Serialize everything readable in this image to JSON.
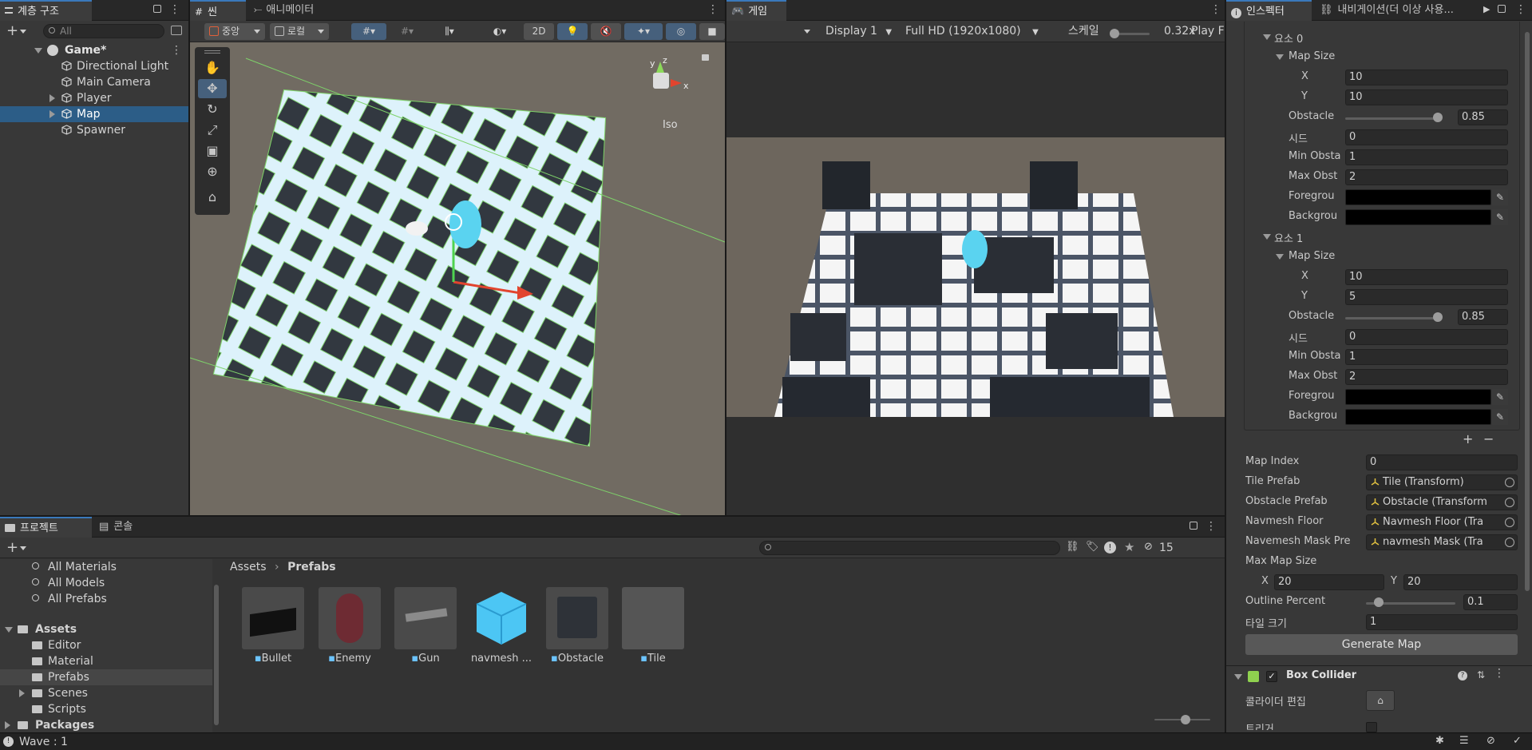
{
  "hierarchy": {
    "tab_label": "계층 구조",
    "search_placeholder": "All",
    "scene_name": "Game*",
    "items": [
      "Directional Light",
      "Main Camera",
      "Player",
      "Map",
      "Spawner"
    ]
  },
  "scene_view": {
    "tab_label": "씬",
    "animator_tab_label": "애니메이터",
    "pivot_label": "중앙",
    "space_label": "로컬",
    "mode_2d_label": "2D",
    "iso_label": "Iso",
    "gizmo_axes": [
      "x",
      "y",
      "z"
    ]
  },
  "game_view": {
    "tab_label": "게임",
    "display_label": "Display 1",
    "resolution_label": "Full HD (1920x1080)",
    "scale_label": "스케일",
    "scale_value": "0.32x",
    "play_label": "Play F"
  },
  "inspector": {
    "tab_label": "인스펙터",
    "navigation_tab_label": "내비게이션(더 이상 사용...",
    "elements": [
      {
        "title": "요소 0",
        "map_size_label": "Map Size",
        "x_label": "X",
        "x_value": "10",
        "y_label": "Y",
        "y_value": "10",
        "obstacle_label": "Obstacle",
        "obstacle_value": "0.85",
        "obstacle_fraction": 0.85,
        "seed_label": "시드",
        "seed_value": "0",
        "min_label": "Min Obsta",
        "min_value": "1",
        "max_label": "Max Obst",
        "max_value": "2",
        "fg_label": "Foregrou",
        "fg_color": "#000000",
        "bg_label": "Backgrou",
        "bg_color": "#000000"
      },
      {
        "title": "요소 1",
        "map_size_label": "Map Size",
        "x_label": "X",
        "x_value": "10",
        "y_label": "Y",
        "y_value": "5",
        "obstacle_label": "Obstacle",
        "obstacle_value": "0.85",
        "obstacle_fraction": 0.85,
        "seed_label": "시드",
        "seed_value": "0",
        "min_label": "Min Obsta",
        "min_value": "1",
        "max_label": "Max Obst",
        "max_value": "2",
        "fg_label": "Foregrou",
        "fg_color": "#000000",
        "bg_label": "Backgrou",
        "bg_color": "#000000"
      }
    ],
    "add_label": "+",
    "remove_label": "−",
    "map_index_label": "Map Index",
    "map_index_value": "0",
    "tile_prefab_label": "Tile Prefab",
    "tile_prefab_value": "Tile (Transform)",
    "obstacle_prefab_label": "Obstacle Prefab",
    "obstacle_prefab_value": "Obstacle (Transform",
    "navmesh_floor_label": "Navmesh Floor",
    "navmesh_floor_value": "Navmesh Floor (Tra",
    "navmask_label": "Navemesh Mask Pre",
    "navmask_value": "navmesh Mask (Tra",
    "max_map_size_label": "Max Map Size",
    "max_x_label": "X",
    "max_x_value": "20",
    "max_y_label": "Y",
    "max_y_value": "20",
    "outline_label": "Outline Percent",
    "outline_value": "0.1",
    "outline_fraction": 0.1,
    "tile_size_label": "타일 크기",
    "tile_size_value": "1",
    "generate_label": "Generate Map",
    "box_collider_label": "Box Collider",
    "edit_collider_label": "콜라이더 편집",
    "trigger_label": "트리거"
  },
  "project": {
    "tab_label": "프로젝트",
    "console_tab_label": "콘솔",
    "hidden_count": "15",
    "favorites": [
      "All Materials",
      "All Models",
      "All Prefabs"
    ],
    "assets_label": "Assets",
    "folders": [
      "Editor",
      "Material",
      "Prefabs",
      "Scenes",
      "Scripts"
    ],
    "packages_label": "Packages",
    "breadcrumb_root": "Assets",
    "breadcrumb_current": "Prefabs",
    "asset_items": [
      "Bullet",
      "Enemy",
      "Gun",
      "navmesh ...",
      "Obstacle",
      "Tile"
    ]
  },
  "status": {
    "message": "Wave : 1"
  },
  "colors": {
    "selection": "#2c5d87",
    "accent": "#3a79bb",
    "panel": "#383838",
    "cube_blue": "#4cc6f4"
  }
}
